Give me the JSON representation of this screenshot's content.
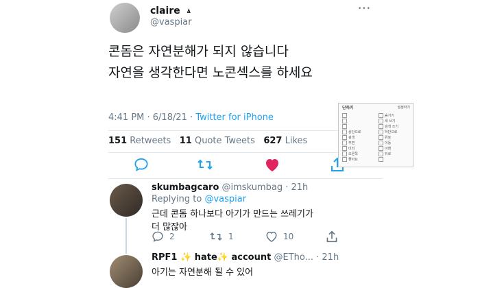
{
  "tweet": {
    "author_name": "claire",
    "author_handle": "@vaspiar",
    "verified_glyph": "ㅿ",
    "more_glyph": "•••",
    "text_line1": "콘돔은 자연분해가 되지 않습니다",
    "text_line2": "자연을 생각한다면 노콘섹스를 하세요",
    "time": "4:41 PM · 6/18/21 ·",
    "source": "Twitter for iPhone",
    "retweets_count": "151",
    "retweets_label": "Retweets",
    "quotes_count": "11",
    "quotes_label": "Quote Tweets",
    "likes_count": "627",
    "likes_label": "Likes"
  },
  "replies": [
    {
      "name": "skumbagcaro",
      "handle": "@imskumbag",
      "time": "· 21h",
      "replying_prefix": "Replying to",
      "replying_to": "@vaspiar",
      "line1": "근데 콘돔 하나보다 아기가 만드는 쓰레기가",
      "line2": "더 많잖아",
      "reply_count": "2",
      "retweet_count": "1",
      "like_count": "10"
    },
    {
      "name": "RPF1 ✨ hate✨ account",
      "handle": "@ETho...",
      "time": "· 21h",
      "line1": "아기는 자연분해 될 수 있어"
    }
  ],
  "shortcut_panel": {
    "title": "단축키",
    "right_label": "설정하기",
    "rows": [
      [
        "",
        "숨기기"
      ],
      [
        "",
        "새 쓰기"
      ],
      [
        "",
        "검색 쓰기"
      ],
      [
        "상단으로",
        "하단으로"
      ],
      [
        "검색",
        "위로"
      ],
      [
        "주변",
        "이동"
      ],
      [
        "미리",
        "아래"
      ],
      [
        "오른쪽",
        "뒤로"
      ],
      [
        "좋아요",
        ""
      ]
    ]
  },
  "colors": {
    "accent": "#1da1f2",
    "like": "#e0245e",
    "muted": "#657786"
  }
}
